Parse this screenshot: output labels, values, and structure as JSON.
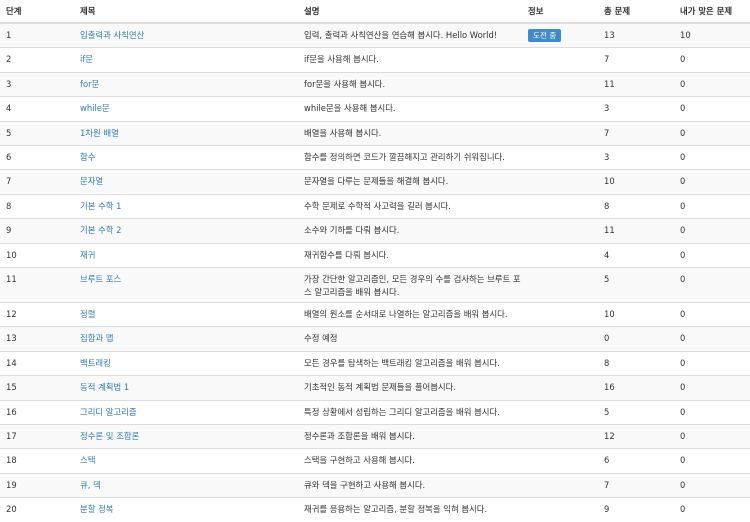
{
  "header": {
    "step": "단계",
    "title": "제목",
    "desc": "설명",
    "info": "정보",
    "total": "총 문제",
    "solved": "내가 맞은 문제"
  },
  "rows": [
    {
      "step": "1",
      "title": "입출력과 사칙연산",
      "desc": "입력, 출력과 사칙연산을 연습해 봅시다. Hello World!",
      "info": "도전 중",
      "total": "13",
      "solved": "10"
    },
    {
      "step": "2",
      "title": "if문",
      "desc": "if문을 사용해 봅시다.",
      "info": "",
      "total": "7",
      "solved": "0"
    },
    {
      "step": "3",
      "title": "for문",
      "desc": "for문을 사용해 봅시다.",
      "info": "",
      "total": "11",
      "solved": "0"
    },
    {
      "step": "4",
      "title": "while문",
      "desc": "while문을 사용해 봅시다.",
      "info": "",
      "total": "3",
      "solved": "0"
    },
    {
      "step": "5",
      "title": "1차원 배열",
      "desc": "배열을 사용해 봅시다.",
      "info": "",
      "total": "7",
      "solved": "0"
    },
    {
      "step": "6",
      "title": "함수",
      "desc": "함수를 정의하면 코드가 깔끔해지고 관리하기 쉬워집니다.",
      "info": "",
      "total": "3",
      "solved": "0"
    },
    {
      "step": "7",
      "title": "문자열",
      "desc": "문자열을 다루는 문제들을 해결해 봅시다.",
      "info": "",
      "total": "10",
      "solved": "0"
    },
    {
      "step": "8",
      "title": "기본 수학 1",
      "desc": "수학 문제로 수학적 사고력을 길러 봅시다.",
      "info": "",
      "total": "8",
      "solved": "0"
    },
    {
      "step": "9",
      "title": "기본 수학 2",
      "desc": "소수와 기하를 다뤄 봅시다.",
      "info": "",
      "total": "11",
      "solved": "0"
    },
    {
      "step": "10",
      "title": "재귀",
      "desc": "재귀함수를 다뤄 봅시다.",
      "info": "",
      "total": "4",
      "solved": "0"
    },
    {
      "step": "11",
      "title": "브루트 포스",
      "desc": "가장 간단한 알고리즘인, 모든 경우의 수를 검사하는 브루트 포스 알고리즘을 배워 봅시다.",
      "info": "",
      "total": "5",
      "solved": "0",
      "tall": true
    },
    {
      "step": "12",
      "title": "정렬",
      "desc": "배열의 원소를 순서대로 나열하는 알고리즘을 배워 봅시다.",
      "info": "",
      "total": "10",
      "solved": "0"
    },
    {
      "step": "13",
      "title": "집합과 맵",
      "desc": "수정 예정",
      "info": "",
      "total": "0",
      "solved": "0"
    },
    {
      "step": "14",
      "title": "백트래킹",
      "desc": "모든 경우를 탐색하는 백트래킹 알고리즘을 배워 봅시다.",
      "info": "",
      "total": "8",
      "solved": "0"
    },
    {
      "step": "15",
      "title": "동적 계획법 1",
      "desc": "기초적인 동적 계획법 문제들을 풀어봅시다.",
      "info": "",
      "total": "16",
      "solved": "0"
    },
    {
      "step": "16",
      "title": "그리디 알고리즘",
      "desc": "특정 상황에서 성립하는 그리디 알고리즘을 배워 봅시다.",
      "info": "",
      "total": "5",
      "solved": "0"
    },
    {
      "step": "17",
      "title": "정수론 및 조합론",
      "desc": "정수론과 조합론을 배워 봅시다.",
      "info": "",
      "total": "12",
      "solved": "0"
    },
    {
      "step": "18",
      "title": "스택",
      "desc": "스택을 구현하고 사용해 봅시다.",
      "info": "",
      "total": "6",
      "solved": "0"
    },
    {
      "step": "19",
      "title": "큐, 덱",
      "desc": "큐와 덱을 구현하고 사용해 봅시다.",
      "info": "",
      "total": "7",
      "solved": "0"
    },
    {
      "step": "20",
      "title": "분할 정복",
      "desc": "재귀를 응용하는 알고리즘, 분할 정복을 익혀 봅시다.",
      "info": "",
      "total": "9",
      "solved": "0"
    }
  ]
}
